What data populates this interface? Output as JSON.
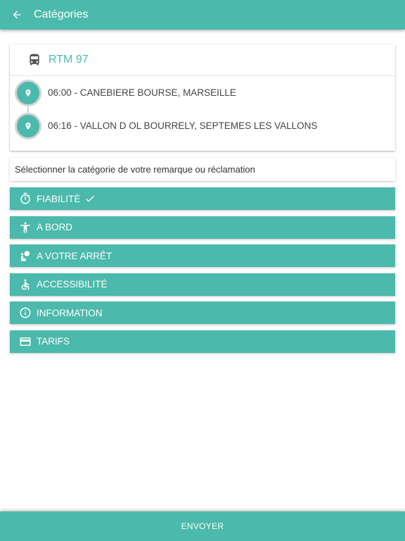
{
  "appbar": {
    "title": "Catégories",
    "back_icon": "arrow-left-icon"
  },
  "trip": {
    "line_icon": "bus-icon",
    "line_name": "RTM 97",
    "stops": [
      {
        "text": "06:00 - CANEBIERE BOURSE, MARSEILLE",
        "icon": "location-pin-icon"
      },
      {
        "text": "06:16 - VALLON D OL BOURRELY, SEPTEMES LES VALLONS",
        "icon": "location-pin-icon"
      }
    ]
  },
  "instruction": "Sélectionner la catégorie de votre remarque ou réclamation",
  "categories": [
    {
      "label": "FIABILITÉ",
      "icon": "stopwatch-icon",
      "selected": true
    },
    {
      "label": "A BORD",
      "icon": "person-standing-icon",
      "selected": false
    },
    {
      "label": "A VOTRE ARRÊT",
      "icon": "waiting-person-icon",
      "selected": false
    },
    {
      "label": "ACCESSIBILITÉ",
      "icon": "wheelchair-icon",
      "selected": false
    },
    {
      "label": "INFORMATION",
      "icon": "info-icon",
      "selected": false
    },
    {
      "label": "TARIFS",
      "icon": "credit-card-icon",
      "selected": false
    }
  ],
  "send_label": "ENVOYER",
  "colors": {
    "accent": "#4bb9ab",
    "on_accent": "#ffffff",
    "text": "#444444"
  }
}
